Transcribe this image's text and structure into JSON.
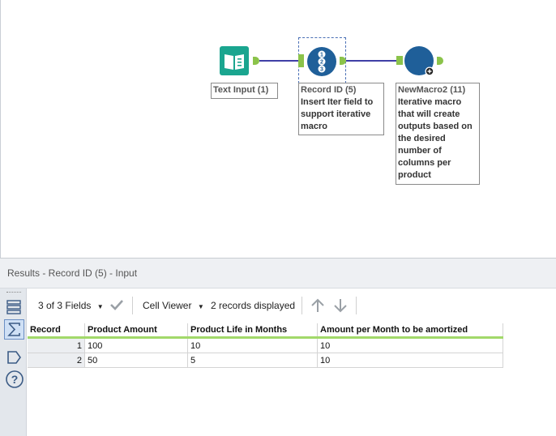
{
  "canvas": {
    "tools": {
      "text_input": {
        "annotation": "Text Input (1)"
      },
      "record_id": {
        "annotation_title": "Record ID (5)",
        "annotation_text": "Insert Iter field to support iterative macro"
      },
      "macro": {
        "annotation_title": "NewMacro2 (11)",
        "annotation_text": "Iterative macro that will create outputs based on the desired number of columns per product"
      }
    }
  },
  "results": {
    "title": "Results - Record ID (5) - Input",
    "toolbar": {
      "fields": "3 of 3 Fields",
      "cell_viewer": "Cell Viewer",
      "records": "2 records displayed"
    },
    "columns": [
      "Record",
      "Product Amount",
      "Product Life in Months",
      "Amount per Month to be amortized"
    ],
    "rows": [
      [
        "1",
        "100",
        "10",
        "10"
      ],
      [
        "2",
        "50",
        "5",
        "10"
      ]
    ]
  },
  "colors": {
    "connector": "#3f3fa6",
    "anchor": "#8bc34a",
    "tool_teal": "#1aa58f",
    "tool_blue": "#1f5f99"
  }
}
